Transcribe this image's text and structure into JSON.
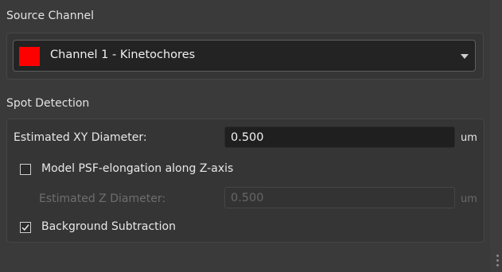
{
  "source_channel": {
    "title": "Source Channel",
    "selected": {
      "label": "Channel 1 - Kinetochores",
      "color": "#ff0000"
    },
    "dropdown_icon": "chevron-down-icon"
  },
  "spot_detection": {
    "title": "Spot Detection",
    "xy_diameter": {
      "label": "Estimated XY Diameter:",
      "value": "0.500",
      "unit": "um"
    },
    "psf_elongation": {
      "label": "Model PSF-elongation along Z-axis",
      "checked": false
    },
    "z_diameter": {
      "label": "Estimated Z Diameter:",
      "value": "0.500",
      "unit": "um",
      "enabled": false
    },
    "background_subtraction": {
      "label": "Background Subtraction",
      "checked": true
    }
  }
}
